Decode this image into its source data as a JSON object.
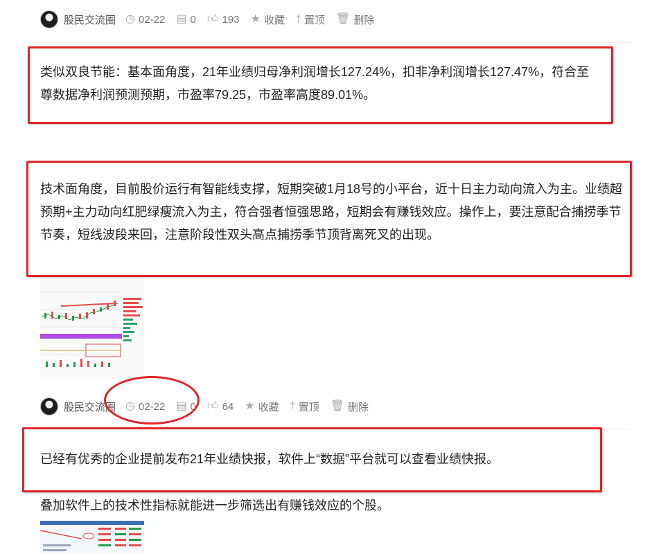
{
  "posts": [
    {
      "author": "股民交流圈",
      "date": "02-22",
      "comments": "0",
      "likes": "193",
      "favorite_label": "收藏",
      "pin_label": "置顶",
      "delete_label": "删除",
      "paragraphs": [
        "类似双良节能：基本面角度，21年业绩归母净利润增长127.24%，扣非净利润增长127.47%，符合至尊数据净利润预测预期，市盈率79.25，市盈率高度89.01%。",
        "技术面角度，目前股价运行有智能线支撑，短期突破1月18号的小平台，近十日主力动向流入为主。业绩超预期+主力动向红肥绿瘦流入为主，符合强者恒强思路，短期会有赚钱效应。操作上，要注意配合捕捞季节节奏，短线波段来回，注意阶段性双头高点捕捞季节顶背离死叉的出现。"
      ]
    },
    {
      "author": "股民交流圈",
      "date": "02-22",
      "comments": "0",
      "likes": "64",
      "favorite_label": "收藏",
      "pin_label": "置顶",
      "delete_label": "删除",
      "paragraphs": [
        "已经有优秀的企业提前发布21年业绩快报，软件上“数据”平台就可以查看业绩快报。",
        "叠加软件上的技术性指标就能进一步筛选出有赚钱效应的个股。"
      ]
    }
  ],
  "icons": {
    "clock": "clock-icon",
    "comment": "comment-icon",
    "like": "thumbs-up-icon",
    "star": "star-icon",
    "pin": "pin-top-icon",
    "trash": "trash-icon"
  },
  "colors": {
    "highlight": "#e0242a",
    "meta_text": "#777777",
    "body_text": "#222222",
    "chart_purple": "#b04ce6",
    "chart_red": "#e54b4b",
    "chart_green": "#1e9e4a"
  }
}
